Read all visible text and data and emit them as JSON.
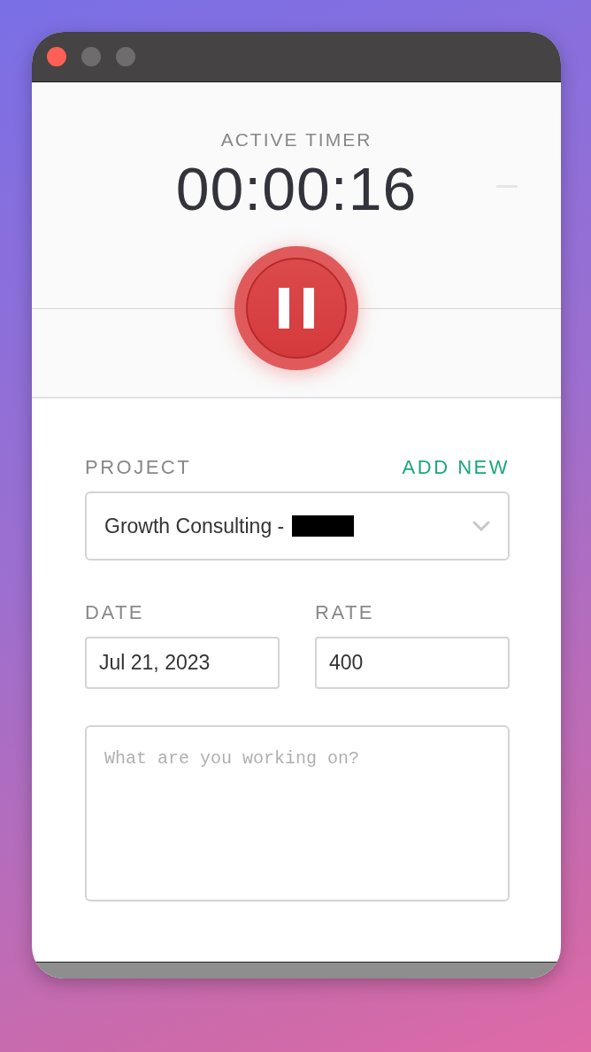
{
  "window": {
    "controls": [
      {
        "color": "#fe5f57"
      },
      {
        "color": "#6e6c6d"
      },
      {
        "color": "#6e6c6d"
      }
    ]
  },
  "timer": {
    "label": "ACTIVE TIMER",
    "time": "00:00:16",
    "running": true
  },
  "project": {
    "label": "PROJECT",
    "add_link": "ADD NEW",
    "value": "Growth Consulting -",
    "redacted": true
  },
  "date": {
    "label": "DATE",
    "value": "Jul 21, 2023"
  },
  "rate": {
    "label": "RATE",
    "value": "400"
  },
  "notes": {
    "placeholder": "What are you working on?"
  }
}
